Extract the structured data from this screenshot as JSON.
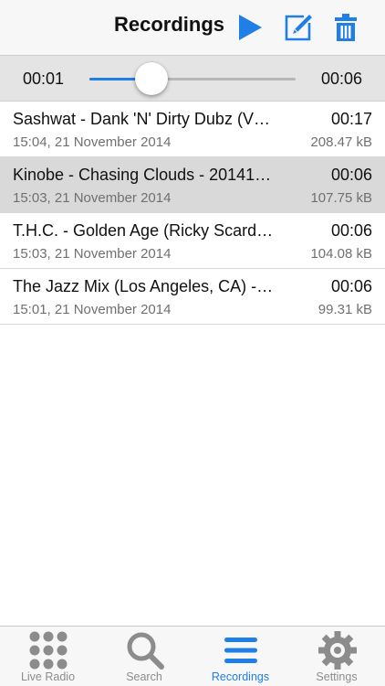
{
  "header": {
    "title": "Recordings",
    "play_icon": "play-icon",
    "edit_icon": "edit-icon",
    "trash_icon": "trash-icon"
  },
  "player": {
    "current_time": "00:01",
    "total_time": "00:06",
    "progress": 0.3
  },
  "recordings": [
    {
      "title": "Sashwat - Dank 'N' Dirty Dubz (V…",
      "date": "15:04, 21 November 2014",
      "duration": "00:17",
      "size": "208.47 kB",
      "selected": false
    },
    {
      "title": "Kinobe - Chasing Clouds - 20141…",
      "date": "15:03, 21 November 2014",
      "duration": "00:06",
      "size": "107.75 kB",
      "selected": true
    },
    {
      "title": "T.H.C. - Golden Age (Ricky Scard…",
      "date": "15:03, 21 November 2014",
      "duration": "00:06",
      "size": "104.08 kB",
      "selected": false
    },
    {
      "title": "The Jazz Mix (Los Angeles, CA) -…",
      "date": "15:01, 21 November 2014",
      "duration": "00:06",
      "size": "99.31 kB",
      "selected": false
    }
  ],
  "tabs": [
    {
      "label": "Live Radio",
      "icon": "grid-dots-icon",
      "active": false
    },
    {
      "label": "Search",
      "icon": "magnifier-icon",
      "active": false
    },
    {
      "label": "Recordings",
      "icon": "list-icon",
      "active": true
    },
    {
      "label": "Settings",
      "icon": "gear-icon",
      "active": false
    }
  ],
  "colors": {
    "accent": "#1f7fe6",
    "inactive": "#8c8c8c",
    "selected_row": "#d9d9d9"
  }
}
